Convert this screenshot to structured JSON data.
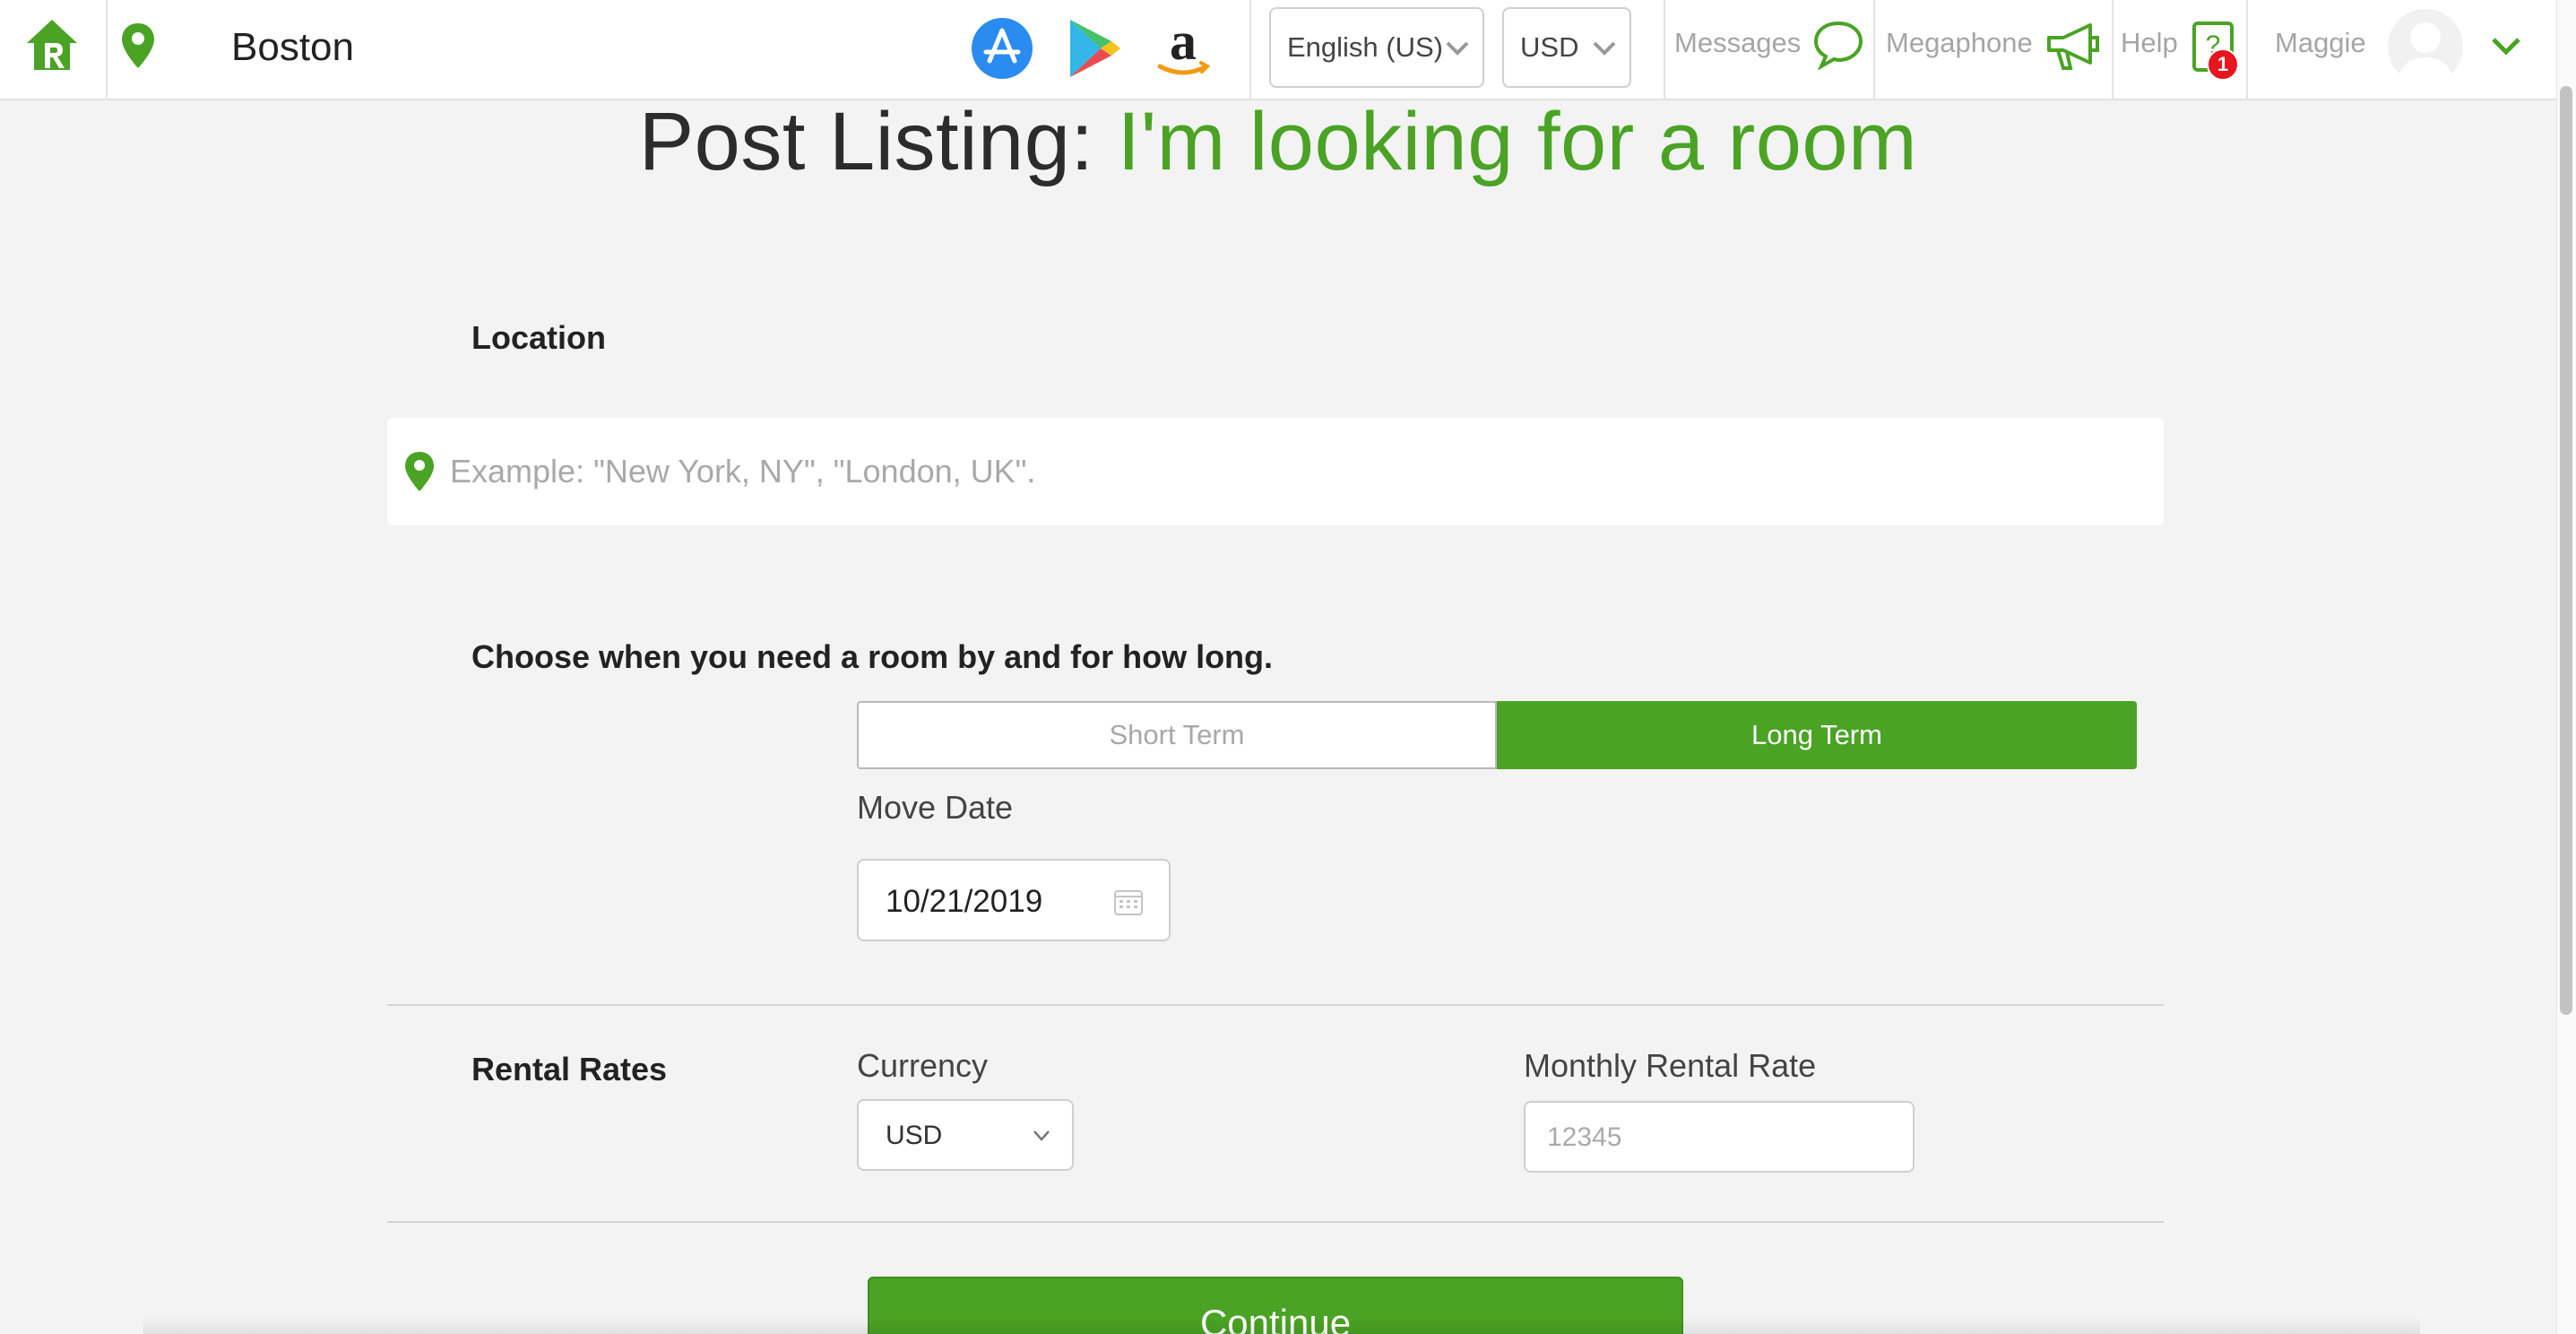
{
  "header": {
    "city": "Boston",
    "apps": [
      {
        "icon": "app-store-icon"
      },
      {
        "icon": "google-play-icon"
      },
      {
        "icon": "amazon-icon"
      }
    ],
    "language": "English (US)",
    "currency": "USD",
    "nav": {
      "messages": "Messages",
      "megaphone": "Megaphone",
      "help": "Help",
      "help_badge": "1",
      "user": "Maggie"
    }
  },
  "page": {
    "title_prefix": "Post Listing: ",
    "title_accent": "I'm looking for a room"
  },
  "location": {
    "label": "Location",
    "placeholder": "Example: \"New York, NY\", \"London, UK\"."
  },
  "timing": {
    "label": "Choose when you need a room by and for how long.",
    "options": [
      "Short Term",
      "Long Term"
    ],
    "selected": "Long Term",
    "move_date_label": "Move Date",
    "move_date": "10/21/2019"
  },
  "rates": {
    "label": "Rental Rates",
    "currency_label": "Currency",
    "currency_value": "USD",
    "monthly_label": "Monthly Rental Rate",
    "monthly_placeholder": "12345"
  },
  "actions": {
    "continue": "Continue"
  },
  "colors": {
    "accent": "#4aa324",
    "badge": "#e5161f"
  }
}
